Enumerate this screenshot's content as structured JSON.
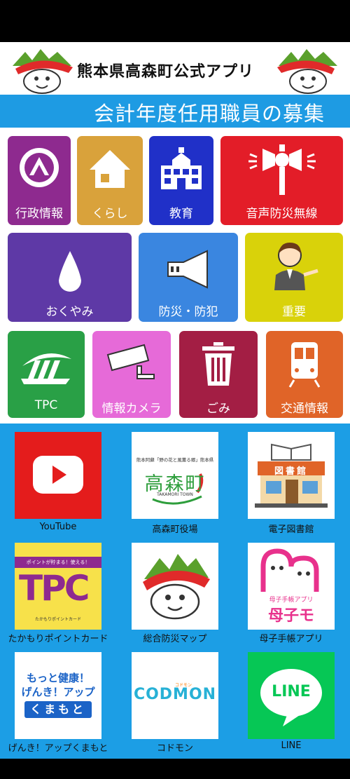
{
  "header": {
    "title": "熊本県高森町公式アプリ"
  },
  "ticker": {
    "text": "会計年度任用職員の募集"
  },
  "menu": {
    "row1": [
      {
        "label": "行政情報",
        "color": "#8e2a8f",
        "icon": "mountain-logo-icon"
      },
      {
        "label": "くらし",
        "color": "#d9a23b",
        "icon": "house-icon"
      },
      {
        "label": "教育",
        "color": "#2030c8",
        "icon": "school-icon"
      },
      {
        "label": "音声防災無線",
        "color": "#e31d28",
        "icon": "loudspeaker-icon"
      }
    ],
    "row2": [
      {
        "label": "おくやみ",
        "color": "#5e39a6",
        "icon": "drop-icon"
      },
      {
        "label": "防災・防犯",
        "color": "#3a86e0",
        "icon": "megaphone-icon"
      },
      {
        "label": "重要",
        "color": "#d9d20a",
        "icon": "staff-icon"
      }
    ],
    "row3": [
      {
        "label": "TPC",
        "color": "#29a046",
        "icon": "tpc-logo-icon"
      },
      {
        "label": "情報カメラ",
        "color": "#e66ad8",
        "icon": "camera-icon"
      },
      {
        "label": "ごみ",
        "color": "#a31e44",
        "icon": "trash-icon"
      },
      {
        "label": "交通情報",
        "color": "#e06428",
        "icon": "train-icon"
      }
    ]
  },
  "links": [
    {
      "label": "YouTube",
      "icon": "youtube-icon"
    },
    {
      "label": "高森町役場",
      "icon": "town-office-logo-icon",
      "caption": "熊本阿蘇「野の花と風薫る郷」熊本県",
      "logo_text": "高森町",
      "logo_sub": "TAKAMORI TOWN"
    },
    {
      "label": "電子図書館",
      "icon": "library-icon",
      "sign": "図書館"
    },
    {
      "label": "たかもりポイントカード",
      "icon": "point-card-icon",
      "banner": "ポイントが貯まる！使える！",
      "logo": "TPC",
      "footnote": "たかもりポイントカード"
    },
    {
      "label": "総合防災マップ",
      "icon": "mascot-icon"
    },
    {
      "label": "母子手帳アプリ",
      "icon": "boshimo-icon",
      "sub": "母子手帳アプリ",
      "logo": "母子モ"
    },
    {
      "label": "げんき！アップくまもと",
      "icon": "genki-up-icon",
      "line1": "もっと健康！",
      "line2": "げんき！アップ",
      "line3": "くまもと"
    },
    {
      "label": "コドモン",
      "icon": "codmon-icon",
      "small": "コドモン",
      "logo": "CODMON"
    },
    {
      "label": "LINE",
      "icon": "line-icon",
      "logo": "LINE"
    }
  ]
}
